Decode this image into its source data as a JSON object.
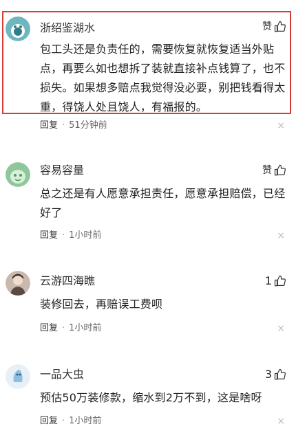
{
  "comments": [
    {
      "username": "浙绍鉴湖水",
      "like_label": "赞",
      "content": "包工头还是负责任的，需要恢复就恢复适当外贴点，再要么如也想拆了装就直接补点钱算了，也不损失。如果想多赔点我觉得没必要，别把钱看得太重，得饶人处且饶人，有福报的。",
      "reply_label": "回复",
      "separator": "·",
      "time": "51分钟前",
      "close_symbol": "×",
      "avatar_colors": {
        "bg": "#6fb7c0",
        "face": "#2f7f88"
      }
    },
    {
      "username": "容易容量",
      "like_label": "赞",
      "content": "总之还是有人愿意承担责任，愿意承担赔偿，已经好了",
      "reply_label": "回复",
      "separator": "·",
      "time": "1小时前",
      "close_symbol": "×",
      "avatar_colors": {
        "bg": "#8fc79a",
        "face": "#4f9a62"
      }
    },
    {
      "username": "云游四海瞧",
      "like_count": "1",
      "content": "装修回去，再赔误工费呗",
      "reply_label": "回复",
      "separator": "·",
      "time": "1小时前",
      "close_symbol": "×",
      "avatar_colors": {
        "bg": "#c9b9ad",
        "face": "#5a4a44"
      }
    },
    {
      "username": "一品大虫",
      "like_count": "3",
      "content": "预估50万装修款，缩水到2万不到，这是啥呀",
      "reply_label": "回复",
      "separator": "·",
      "time": "1小时前",
      "close_symbol": "×",
      "avatar_colors": {
        "bg": "#e6f0f6",
        "face": "#8fbfe0"
      }
    }
  ],
  "icons": {
    "like": "thumbs-up-icon"
  },
  "accent": {
    "highlight_border": "#d93a3a"
  }
}
